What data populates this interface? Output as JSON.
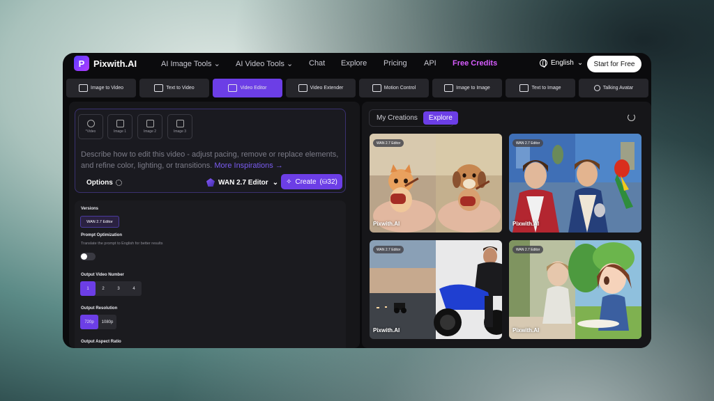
{
  "brand": {
    "name": "Pixwith.AI",
    "logo_letter": "P"
  },
  "nav": {
    "ai_image_tools": "AI Image Tools",
    "ai_video_tools": "AI Video Tools",
    "chat": "Chat",
    "explore": "Explore",
    "pricing": "Pricing",
    "api": "API",
    "free_credits": "Free Credits",
    "language": "English",
    "start_button": "Start for Free"
  },
  "tool_tabs": [
    {
      "label": "Image to Video",
      "icon": "image-to-video-icon"
    },
    {
      "label": "Text to Video",
      "icon": "text-to-video-icon"
    },
    {
      "label": "Video Editor",
      "icon": "video-editor-icon",
      "active": true
    },
    {
      "label": "Video Extender",
      "icon": "video-extender-icon"
    },
    {
      "label": "Motion Control",
      "icon": "motion-control-icon"
    },
    {
      "label": "Image to Image",
      "icon": "image-to-image-icon"
    },
    {
      "label": "Text to Image",
      "icon": "text-to-image-icon"
    },
    {
      "label": "Talking Avatar",
      "icon": "talking-avatar-icon"
    }
  ],
  "upload_slots": [
    "*Video",
    "Image 1",
    "Image 2",
    "Image 3"
  ],
  "prompt": {
    "placeholder": "Describe how to edit this video - adjust pacing, remove or replace elements, and refine color, lighting, or transitions.",
    "more_link": "More Inspirations →"
  },
  "options_label": "Options",
  "model": {
    "name": "WAN 2.7 Editor"
  },
  "create_button": {
    "label": "Create",
    "credits": "32"
  },
  "settings": {
    "versions_label": "Versions",
    "version_chip": "WAN 2.7 Editor",
    "prompt_opt_label": "Prompt Optimization",
    "prompt_opt_desc": "Translate the prompt to English for better results",
    "prompt_opt_enabled": false,
    "output_number_label": "Output Video Number",
    "output_numbers": [
      "1",
      "2",
      "3",
      "4"
    ],
    "output_resolution_label": "Output Resolution",
    "resolutions": [
      "720p",
      "1080p"
    ],
    "aspect_label": "Output Aspect Ratio"
  },
  "gallery": {
    "tabs": [
      "My Creations",
      "Explore"
    ],
    "cards": [
      {
        "badge": "WAN 2.7 Editor",
        "watermark": "Pixwith.AI",
        "alt": "kitten-puppy-guitar"
      },
      {
        "badge": "WAN 2.7 Editor",
        "watermark": "Pixwith.AI",
        "alt": "two-men-parrot-chapel"
      },
      {
        "badge": "WAN 2.7 Editor",
        "watermark": "Pixwith.AI",
        "alt": "motorcycle-road"
      },
      {
        "badge": "WAN 2.7 Editor",
        "watermark": "Pixwith.AI",
        "alt": "child-anime-window"
      }
    ]
  },
  "colors": {
    "accent": "#6c3ee6",
    "free_credits": "#d75cff",
    "app_bg": "#0b0b0d"
  }
}
